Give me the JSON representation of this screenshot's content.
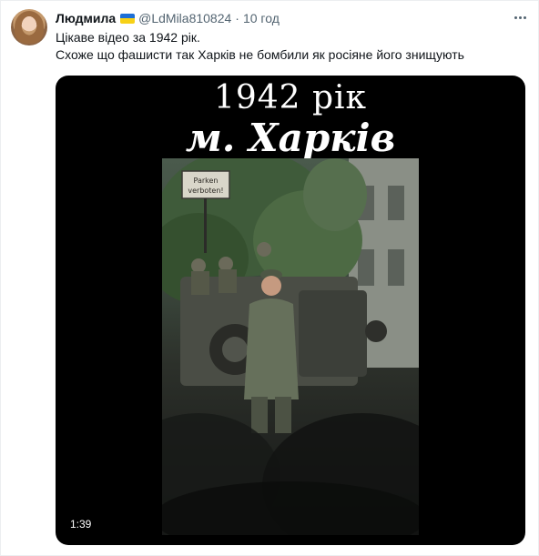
{
  "tweet": {
    "author_name": "Людмила",
    "handle": "@LdMila810824",
    "separator": "·",
    "time": "10 год",
    "text_lines": [
      "Цікаве відео за 1942 рік.",
      "Схоже що фашисти так Харків не бомбили як росіяне його знищують"
    ]
  },
  "video": {
    "overlay_line1": "1942 рік",
    "overlay_line2": "м. Харків",
    "sign_text": "Parken verboten!",
    "duration": "1:39"
  },
  "icons": {
    "flag": "ukraine-flag-icon",
    "more": "more-options-icon"
  },
  "colors": {
    "text_primary": "#0f1419",
    "text_secondary": "#536471",
    "video_bg": "#000000",
    "flag_blue": "#1d6fd6",
    "flag_yellow": "#f7d117"
  }
}
